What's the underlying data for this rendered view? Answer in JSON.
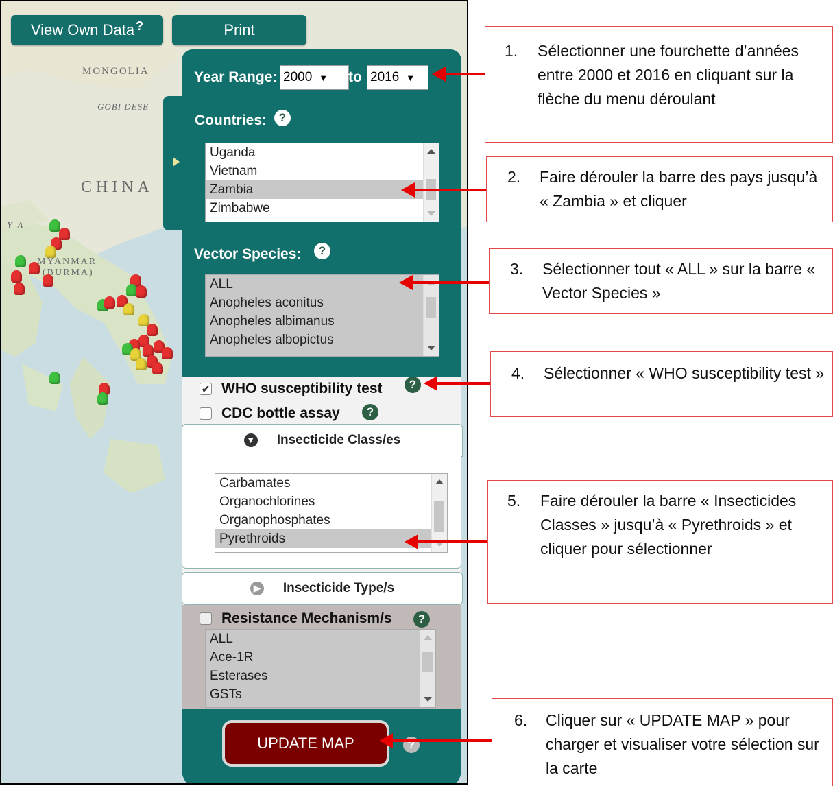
{
  "toolbar": {
    "view_own_data": "View Own Data",
    "view_own_data_help": "?",
    "print": "Print"
  },
  "map": {
    "labels": {
      "mongolia": "MONGOLIA",
      "gobi": "GOBI DESE",
      "china": "CHINA",
      "myanmar_line1": "MYANMAR",
      "myanmar_line2": "(BURMA)",
      "partial": "Y A"
    },
    "marker_colors": {
      "red": "#e53030",
      "green": "#3fbf3f",
      "yellow": "#e8d23a"
    }
  },
  "panel": {
    "year_range_label": "Year Range:",
    "year_from": "2000",
    "year_to_label": "to",
    "year_to": "2016",
    "dropdown_arrow": "▼",
    "countries_label": "Countries:",
    "countries": [
      {
        "label": "Uganda",
        "selected": false
      },
      {
        "label": "Vietnam",
        "selected": false
      },
      {
        "label": "Zambia",
        "selected": true
      },
      {
        "label": "Zimbabwe",
        "selected": false
      }
    ],
    "vector_species_label": "Vector Species:",
    "vector_species": [
      {
        "label": "ALL",
        "selected": true
      },
      {
        "label": "Anopheles aconitus",
        "selected": true
      },
      {
        "label": "Anopheles albimanus",
        "selected": true
      },
      {
        "label": "Anopheles albopictus",
        "selected": true
      }
    ],
    "help": "?",
    "who_test_label": "WHO susceptibility test",
    "who_test_checked": true,
    "cdc_assay_label": "CDC bottle assay",
    "cdc_assay_checked": false,
    "check_mark": "✔",
    "insecticide_class_label": "Insecticide Class/es",
    "insecticide_classes": [
      {
        "label": "Carbamates",
        "selected": false
      },
      {
        "label": "Organochlorines",
        "selected": false
      },
      {
        "label": "Organophosphates",
        "selected": false
      },
      {
        "label": "Pyrethroids",
        "selected": true
      }
    ],
    "insecticide_type_label": "Insecticide Type/s",
    "resistance_label": "Resistance Mechanism/s",
    "resistance_mechanisms": [
      {
        "label": "ALL",
        "selected": true
      },
      {
        "label": "Ace-1R",
        "selected": true
      },
      {
        "label": "Esterases",
        "selected": true
      },
      {
        "label": "GSTs",
        "selected": true
      }
    ],
    "update_map": "UPDATE MAP"
  },
  "callouts": [
    {
      "num": "1.",
      "text": "Sélectionner une fourchette d’années entre 2000 et 2016 en cliquant sur la flèche du menu déroulant"
    },
    {
      "num": "2.",
      "text": "Faire dérouler la barre des pays jusqu’à « Zambia » et cliquer"
    },
    {
      "num": "3.",
      "text": "Sélectionner tout « ALL » sur la barre « Vector Species »"
    },
    {
      "num": "4.",
      "text": "Sélectionner « WHO susceptibility test »"
    },
    {
      "num": "5.",
      "text": "Faire dérouler la barre « Insecticides Classes » jusqu’à « Pyrethroids » et cliquer pour sélectionner"
    },
    {
      "num": "6.",
      "text": "Cliquer sur « UPDATE MAP » pour charger et visualiser votre sélection sur la carte"
    }
  ],
  "colors": {
    "panel_teal": "#12706c",
    "arrow_red": "#e60000",
    "callout_border": "#e04a4a",
    "update_button": "#7a0000"
  }
}
